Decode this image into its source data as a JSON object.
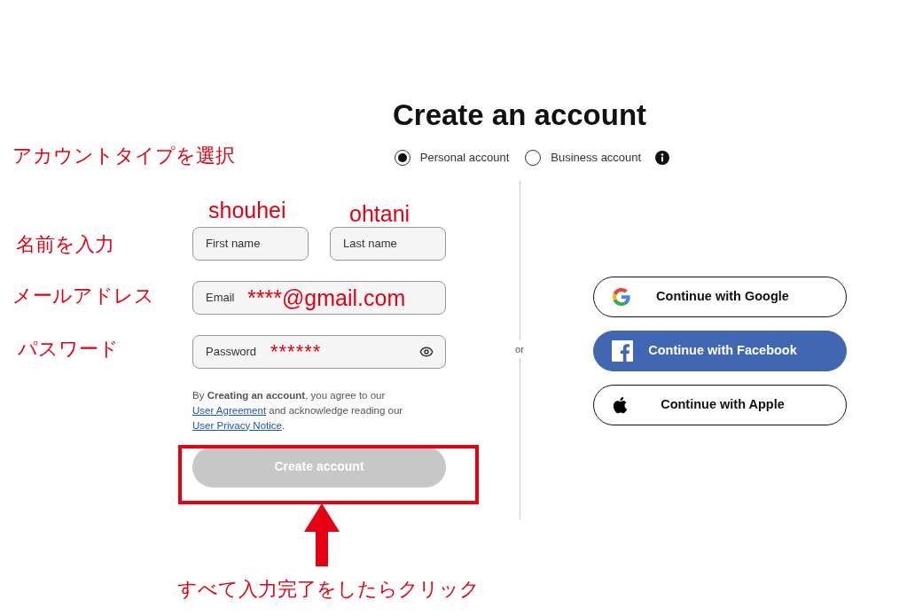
{
  "title": "Create an account",
  "account_types": [
    {
      "label": "Personal account",
      "selected": true
    },
    {
      "label": "Business account",
      "selected": false
    }
  ],
  "form": {
    "first_name": {
      "placeholder": "First name"
    },
    "last_name": {
      "placeholder": "Last name"
    },
    "email": {
      "placeholder": "Email"
    },
    "password": {
      "placeholder": "Password"
    },
    "legal": {
      "before": "By **Creating an account**, you agree to our ",
      "link_1": "User Agreement",
      "middle": " and acknowledge reading our ",
      "link_2": "User Privacy Notice",
      "after": "."
    },
    "submit": {
      "label": "Create account",
      "disabled": true
    }
  },
  "divider": "or",
  "social_buttons": [
    {
      "label": "Continue with Google",
      "kind": "google"
    },
    {
      "label": "Continue with Facebook",
      "kind": "facebook"
    },
    {
      "label": "Continue with Apple",
      "kind": "apple"
    }
  ],
  "annotations": {
    "account_type": "アカウントタイプを選択",
    "name": "名前を入力",
    "email": "メールアドレス",
    "password": "パスワード",
    "first_name_value": "shouhei",
    "last_name_value": "ohtani",
    "email_value": "****@gmail.com",
    "password_value": "******",
    "click_note": "すべて入力完了をしたらクリック"
  }
}
